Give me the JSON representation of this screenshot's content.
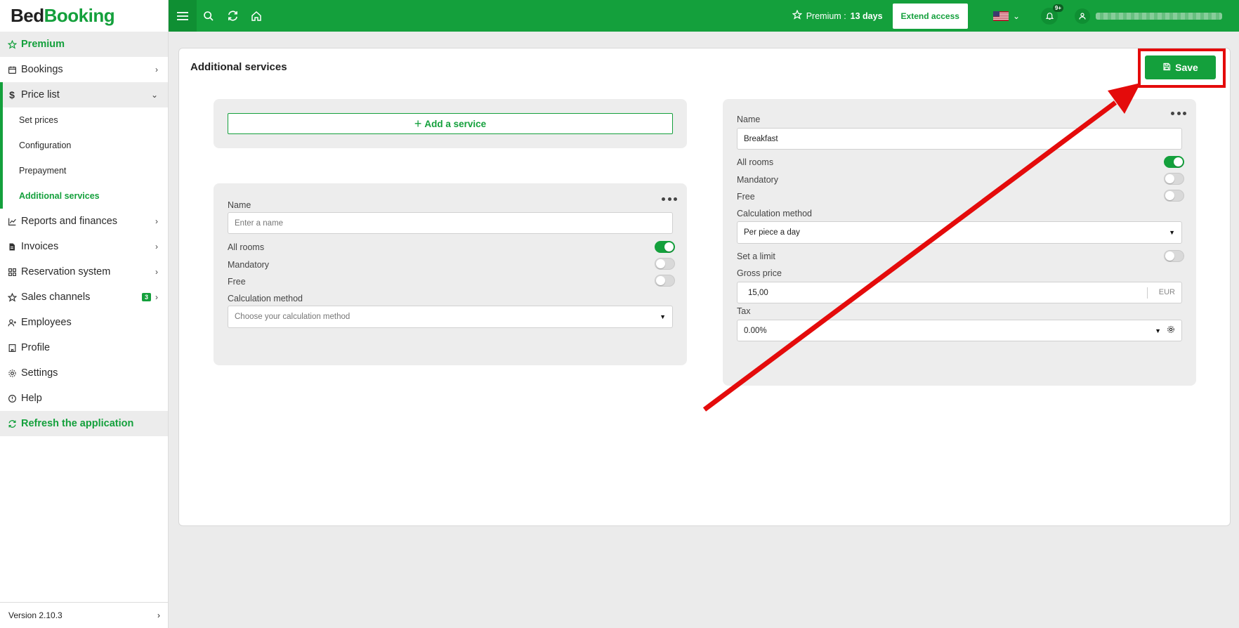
{
  "app": {
    "logo_part1": "Bed",
    "logo_part2": "Booking"
  },
  "sidebar": {
    "premium": "Premium",
    "bookings": "Bookings",
    "price_list": "Price list",
    "sub": {
      "set_prices": "Set prices",
      "configuration": "Configuration",
      "prepayment": "Prepayment",
      "additional_services": "Additional services"
    },
    "reports": "Reports and finances",
    "invoices": "Invoices",
    "reservation": "Reservation system",
    "sales_channels": "Sales channels",
    "sales_badge": "3",
    "employees": "Employees",
    "profile": "Profile",
    "settings": "Settings",
    "help": "Help",
    "refresh": "Refresh the application",
    "version": "Version 2.10.3"
  },
  "topbar": {
    "premium_label": "Premium :",
    "premium_days": "13 days",
    "extend": "Extend access",
    "notif_count": "9+"
  },
  "main": {
    "title": "Additional services",
    "save": "Save",
    "add_service": "Add a service",
    "new_service": {
      "name_label": "Name",
      "name_placeholder": "Enter a name",
      "all_rooms": "All rooms",
      "mandatory": "Mandatory",
      "free": "Free",
      "calc_label": "Calculation method",
      "calc_placeholder": "Choose your calculation method"
    },
    "breakfast": {
      "name_label": "Name",
      "name_value": "Breakfast",
      "all_rooms": "All rooms",
      "mandatory": "Mandatory",
      "free": "Free",
      "calc_label": "Calculation method",
      "calc_value": "Per piece a day",
      "limit": "Set a limit",
      "gross_label": "Gross price",
      "gross_value": "15,00",
      "currency": "EUR",
      "tax_label": "Tax",
      "tax_value": "0.00%"
    }
  },
  "colors": {
    "brand": "#14a03c",
    "annotation": "#e40b0b"
  }
}
